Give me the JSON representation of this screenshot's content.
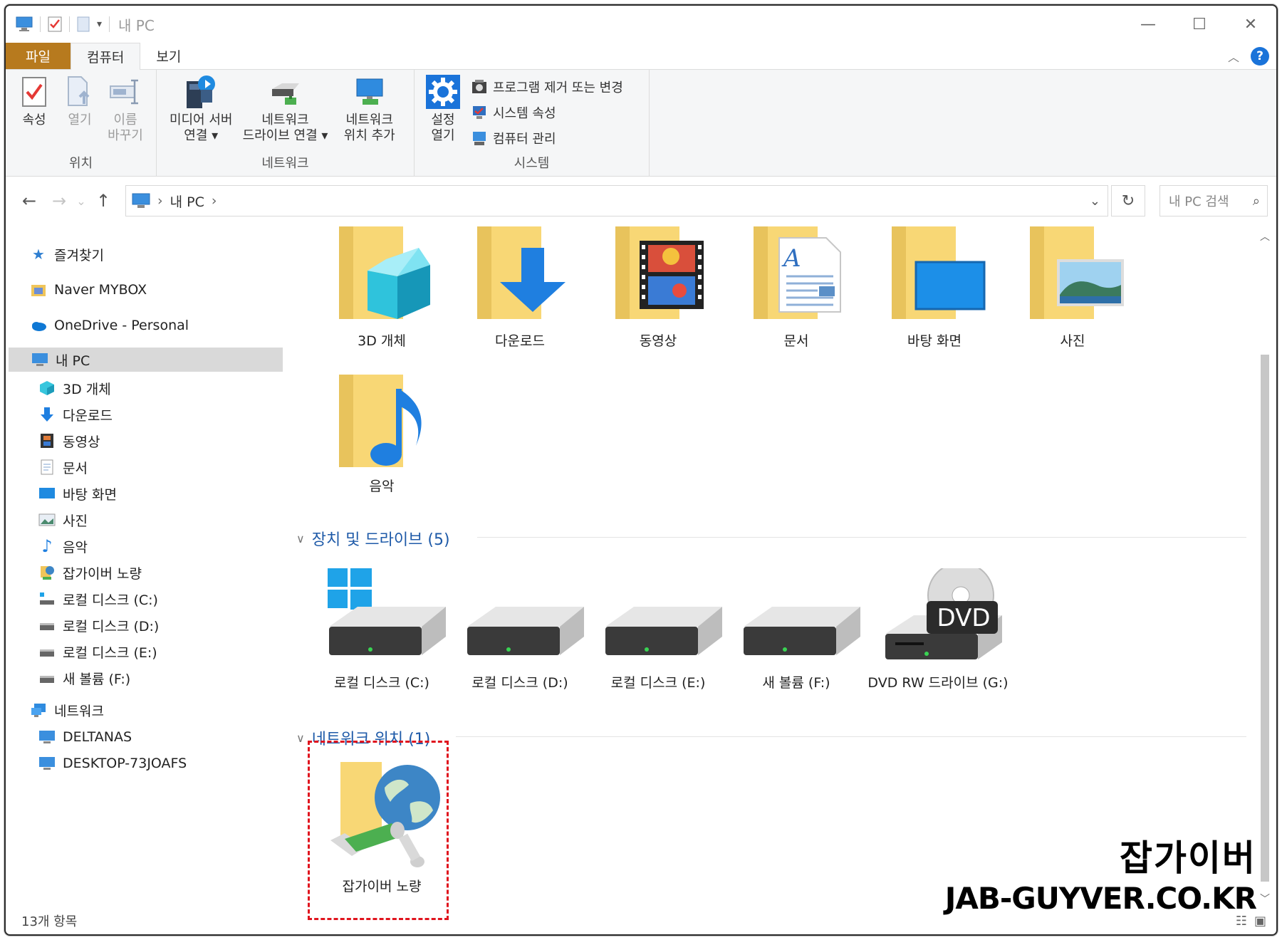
{
  "window": {
    "title": "내 PC"
  },
  "tabs": {
    "file": "파일",
    "computer": "컴퓨터",
    "view": "보기"
  },
  "ribbon": {
    "location": {
      "label": "위치",
      "properties": "속성",
      "open": "열기",
      "rename_l1": "이름",
      "rename_l2": "바꾸기"
    },
    "network": {
      "label": "네트워크",
      "media_l1": "미디어 서버",
      "media_l2": "연결 ▾",
      "mapdrive_l1": "네트워크",
      "mapdrive_l2": "드라이브 연결 ▾",
      "addloc_l1": "네트워크",
      "addloc_l2": "위치 추가"
    },
    "system": {
      "label": "시스템",
      "settings_l1": "설정",
      "settings_l2": "열기",
      "uninstall": "프로그램 제거 또는 변경",
      "sysprops": "시스템 속성",
      "manage": "컴퓨터 관리"
    }
  },
  "address": {
    "path": "내 PC",
    "search_placeholder": "내 PC 검색"
  },
  "sidebar": {
    "quick_access": "즐겨찾기",
    "mybox": "Naver MYBOX",
    "onedrive": "OneDrive - Personal",
    "thispc": "내 PC",
    "items": [
      "3D 개체",
      "다운로드",
      "동영상",
      "문서",
      "바탕 화면",
      "사진",
      "음악",
      "잡가이버 노량",
      "로컬 디스크 (C:)",
      "로컬 디스크 (D:)",
      "로컬 디스크 (E:)",
      "새 볼륨 (F:)"
    ],
    "network": "네트워크",
    "computers": [
      "DELTANAS",
      "DESKTOP-73JOAFS"
    ]
  },
  "folders": [
    "3D 개체",
    "다운로드",
    "동영상",
    "문서",
    "바탕 화면",
    "사진",
    "음악"
  ],
  "devices_header": "장치 및 드라이브 (5)",
  "drives": [
    "로컬 디스크 (C:)",
    "로컬 디스크 (D:)",
    "로컬 디스크 (E:)",
    "새 볼륨 (F:)",
    "DVD RW 드라이브 (G:)"
  ],
  "dvd_badge": "DVD",
  "netloc_header": "네트워크 위치 (1)",
  "netloc_item": "잡가이버 노량",
  "status": {
    "count": "13개 항목"
  },
  "watermark": {
    "line1": "잡가이버",
    "line2": "JAB-GUYVER.CO.KR"
  },
  "colors": {
    "accent": "#1e5aa8",
    "file_tab": "#b77a1e",
    "folder": "#f8d775",
    "highlight_box": "#e0141e"
  }
}
